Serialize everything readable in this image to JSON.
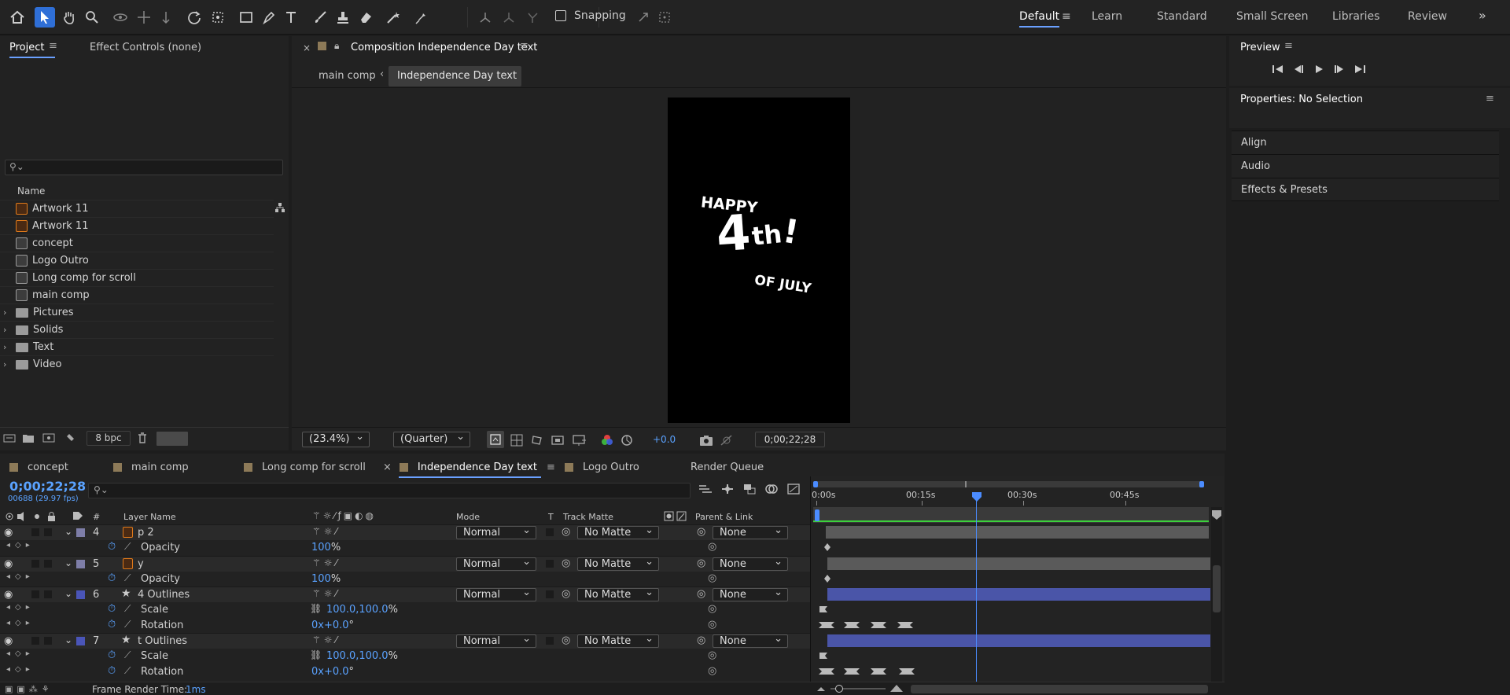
{
  "workspaces": [
    "Default",
    "Learn",
    "Standard",
    "Small Screen",
    "Libraries",
    "Review"
  ],
  "toolbar": {
    "snapping_label": "Snapping"
  },
  "project_panel": {
    "tab_project": "Project",
    "tab_effect_controls": "Effect Controls (none)",
    "name_header": "Name",
    "items": [
      {
        "name": "Artwork 11",
        "type": "ai"
      },
      {
        "name": "Artwork 11",
        "type": "ai"
      },
      {
        "name": "concept",
        "type": "comp"
      },
      {
        "name": "Logo Outro",
        "type": "comp"
      },
      {
        "name": "Long comp for scroll",
        "type": "comp"
      },
      {
        "name": "main comp",
        "type": "comp"
      },
      {
        "name": "Pictures",
        "type": "folder"
      },
      {
        "name": "Solids",
        "type": "folder"
      },
      {
        "name": "Text",
        "type": "folder"
      },
      {
        "name": "Video",
        "type": "folder"
      }
    ],
    "bpc": "8 bpc"
  },
  "composition": {
    "tab_title": "Composition Independence Day text",
    "breadcrumb_parent": "main comp",
    "breadcrumb_current": "Independence Day text",
    "artwork": {
      "line1": "HAPPY",
      "big4": "4",
      "th": "th",
      "excl": "!",
      "line3": "OF JULY"
    },
    "zoom": "(23.4%)",
    "resolution": "(Quarter)",
    "exposure": "+0.0",
    "timecode": "0;00;22;28"
  },
  "right_panels": {
    "preview_title": "Preview",
    "properties_title": "Properties: No Selection",
    "items": [
      "Align",
      "Audio",
      "Effects & Presets"
    ]
  },
  "timeline": {
    "tabs": [
      "concept",
      "main comp",
      "Long comp for scroll",
      "Independence Day text",
      "Logo Outro",
      "Render Queue"
    ],
    "active_tab": "Independence Day text",
    "timecode": "0;00;22;28",
    "frame_info": "00688 (29.97 fps)",
    "headers": {
      "num": "#",
      "layer_name": "Layer Name",
      "mode": "Mode",
      "t": "T",
      "track_matte": "Track Matte",
      "parent": "Parent & Link"
    },
    "ruler": [
      "0:00s",
      "00:15s",
      "00:30s",
      "00:45s"
    ],
    "rows": [
      {
        "kind": "layer",
        "num": "4",
        "name": "p 2",
        "mode": "Normal",
        "matte": "No Matte",
        "parent": "None",
        "icon": "ai",
        "color": "#7e7ea8"
      },
      {
        "kind": "prop",
        "name": "Opacity",
        "value": "100",
        "unit": "%"
      },
      {
        "kind": "layer",
        "num": "5",
        "name": "y",
        "mode": "Normal",
        "matte": "No Matte",
        "parent": "None",
        "icon": "ai",
        "color": "#7e7ea8"
      },
      {
        "kind": "prop",
        "name": "Opacity",
        "value": "100",
        "unit": "%"
      },
      {
        "kind": "layer",
        "num": "6",
        "name": "4 Outlines",
        "mode": "Normal",
        "matte": "No Matte",
        "parent": "None",
        "icon": "star",
        "color": "#4a55b8"
      },
      {
        "kind": "prop",
        "name": "Scale",
        "value": "100.0,100.0",
        "unit": "%"
      },
      {
        "kind": "prop",
        "name": "Rotation",
        "value": "0x+0.0",
        "unit": "°"
      },
      {
        "kind": "layer",
        "num": "7",
        "name": "t Outlines",
        "mode": "Normal",
        "matte": "No Matte",
        "parent": "None",
        "icon": "star",
        "color": "#4a55b8"
      },
      {
        "kind": "prop",
        "name": "Scale",
        "value": "100.0,100.0",
        "unit": "%"
      },
      {
        "kind": "prop",
        "name": "Rotation",
        "value": "0x+0.0",
        "unit": "°"
      }
    ],
    "frame_render_label": "Frame Render Time:",
    "frame_render_value": "1ms"
  }
}
